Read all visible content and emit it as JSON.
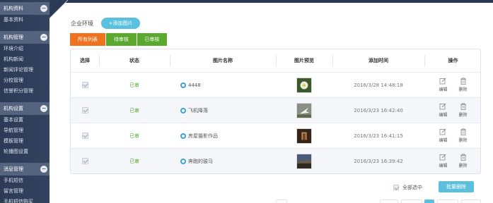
{
  "sidebar": {
    "groups": [
      {
        "title": "机构资料",
        "items": [
          "基本资料"
        ]
      },
      {
        "title": "机构管理",
        "items": [
          "环境介绍",
          "机构新闻",
          "新闻评论管理",
          "分校管理",
          "信誉积分管理"
        ]
      },
      {
        "title": "机构设置",
        "items": [
          "基本设置",
          "导航管理",
          "模板管理",
          "轮播图设置"
        ]
      },
      {
        "title": "消息管理",
        "items": [
          "手机短信",
          "留言管理",
          "手机短信购买"
        ]
      }
    ]
  },
  "header": {
    "title": "企业环境",
    "add_button": "+添加图片"
  },
  "tabs": {
    "all": "所有列表",
    "pending": "待审核",
    "approved": "已审核"
  },
  "table": {
    "columns": [
      "选择",
      "状态",
      "图片名称",
      "图片预览",
      "添加时间",
      "操作"
    ],
    "rows": [
      {
        "status": "已审",
        "name": "4448",
        "time": "2016/3/28 14:48:18",
        "edit": "编辑",
        "delete": "删除"
      },
      {
        "status": "已审",
        "name": "飞机降落",
        "time": "2016/3/23 16:42:40",
        "edit": "编辑",
        "delete": "删除"
      },
      {
        "status": "已审",
        "name": "房屋摄影作品",
        "time": "2016/3/23 16:41:15",
        "edit": "编辑",
        "delete": "删除"
      },
      {
        "status": "已审",
        "name": "奔跑的骏马",
        "time": "2016/3/23 16:39:42",
        "edit": "编辑",
        "delete": "删除"
      }
    ]
  },
  "footer": {
    "select_all": "全部选中",
    "batch_delete": "批量删除"
  },
  "colors": {
    "sidebar_bg": "#2b3a55",
    "accent_blue": "#5bc0de",
    "tab_orange": "#f0711e",
    "tab_green": "#5aa82e"
  },
  "icons": {
    "row_name": "image-icon",
    "edit": "edit-icon",
    "delete": "trash-icon"
  }
}
